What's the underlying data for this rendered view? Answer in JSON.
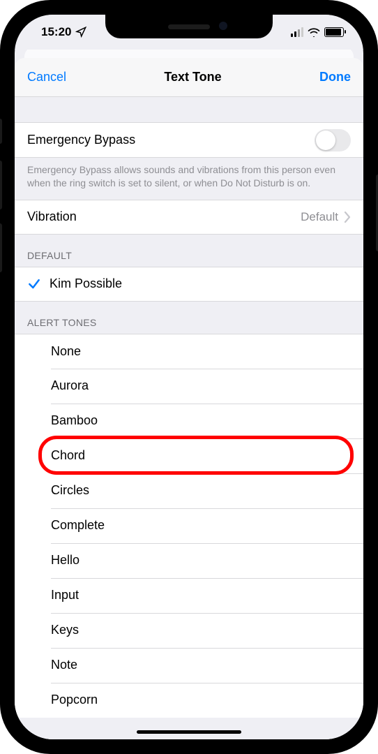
{
  "status": {
    "time": "15:20",
    "location_icon": "navigation-icon"
  },
  "nav": {
    "cancel": "Cancel",
    "title": "Text Tone",
    "done": "Done"
  },
  "emergency": {
    "label": "Emergency Bypass",
    "on": false,
    "description": "Emergency Bypass allows sounds and vibrations from this person even when the ring switch is set to silent, or when Do Not Disturb is on."
  },
  "vibration": {
    "label": "Vibration",
    "value": "Default"
  },
  "default_section": {
    "header": "DEFAULT",
    "selected": "Kim Possible"
  },
  "alert_section": {
    "header": "ALERT TONES",
    "items": [
      "None",
      "Aurora",
      "Bamboo",
      "Chord",
      "Circles",
      "Complete",
      "Hello",
      "Input",
      "Keys",
      "Note",
      "Popcorn"
    ],
    "highlighted_index": 3
  },
  "colors": {
    "tint": "#007aff",
    "bg_grouped": "#efeff4",
    "text_secondary": "#8e8e93",
    "highlight": "#ff0000"
  }
}
